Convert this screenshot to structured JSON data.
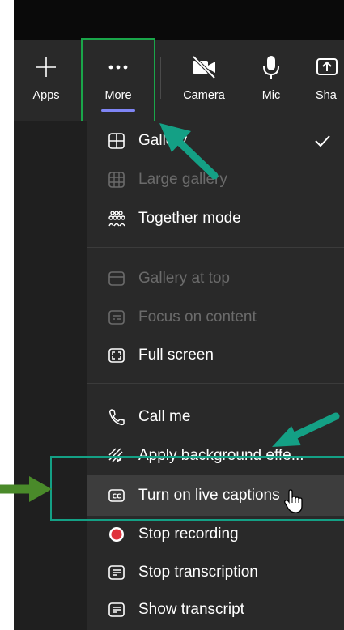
{
  "toolbar": {
    "apps_label": "Apps",
    "more_label": "More",
    "camera_label": "Camera",
    "mic_label": "Mic",
    "share_label": "Sha"
  },
  "menu": {
    "gallery": "Gallery",
    "large_gallery": "Large gallery",
    "together_mode": "Together mode",
    "gallery_at_top": "Gallery at top",
    "focus_on_content": "Focus on content",
    "full_screen": "Full screen",
    "call_me": "Call me",
    "apply_background": "Apply background effe...",
    "turn_on_captions": "Turn on live captions",
    "stop_recording": "Stop recording",
    "stop_transcription": "Stop transcription",
    "show_transcript": "Show transcript"
  },
  "colors": {
    "highlight_green": "#1aa64a",
    "annotation_teal": "#14a085",
    "annotation_arrow_green": "#4a8a2a",
    "more_underline": "#7f85f5",
    "record_red": "#e0333c"
  },
  "icons": {
    "apps": "plus-icon",
    "more": "ellipsis-icon",
    "camera": "camera-off-icon",
    "mic": "microphone-icon",
    "share": "share-icon",
    "gallery": "grid-icon",
    "together": "people-group-icon",
    "full_screen": "fullscreen-icon",
    "call_me": "phone-icon",
    "background": "background-effects-icon",
    "captions": "closed-captions-icon",
    "recording": "record-icon",
    "transcript": "transcript-icon"
  }
}
